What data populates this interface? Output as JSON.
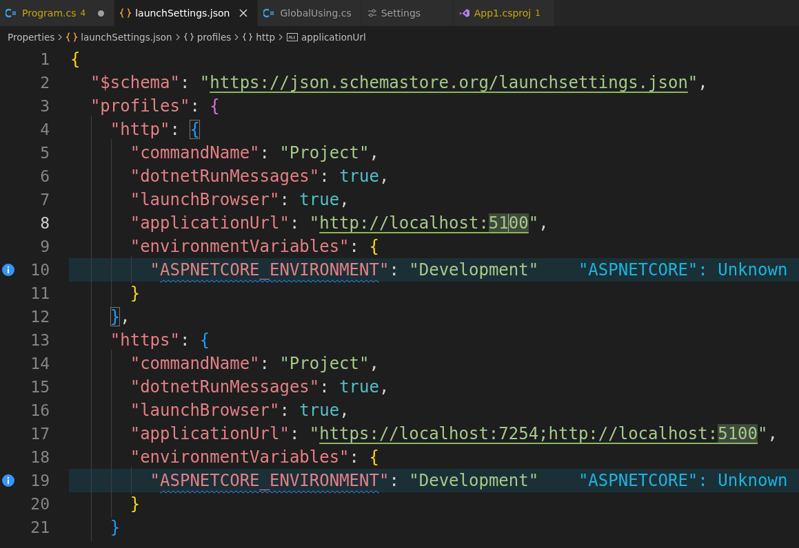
{
  "tabs": [
    {
      "label": "Program.cs",
      "badge": "4",
      "kind": "csharp",
      "warning": true,
      "modified": true,
      "selected": false
    },
    {
      "label": "launchSettings.json",
      "kind": "json",
      "warning": false,
      "modified": false,
      "selected": true
    },
    {
      "label": "GlobalUsing.cs",
      "kind": "csharp",
      "warning": false,
      "modified": false,
      "selected": false
    },
    {
      "label": "Settings",
      "kind": "settings",
      "warning": false,
      "modified": false,
      "selected": false
    },
    {
      "label": "App1.csproj",
      "badge": "1",
      "kind": "project",
      "warning": true,
      "modified": false,
      "selected": false
    }
  ],
  "breadcrumb": [
    {
      "label": "Properties",
      "kind": "folder"
    },
    {
      "label": "launchSettings.json",
      "kind": "json"
    },
    {
      "label": "profiles",
      "kind": "object"
    },
    {
      "label": "http",
      "kind": "object"
    },
    {
      "label": "applicationUrl",
      "kind": "string"
    }
  ],
  "lines": [
    {
      "number": "1",
      "current": false,
      "highlighted": false,
      "info": false,
      "tokens": [
        {
          "text": "{",
          "kind": "b1"
        }
      ]
    },
    {
      "number": "2",
      "current": false,
      "highlighted": false,
      "info": false,
      "tokens": [
        {
          "text": "\"$schema\"",
          "kind": "key"
        },
        {
          "text": ":",
          "kind": "punct"
        },
        {
          "text": "\"",
          "kind": "string",
          "space": true
        },
        {
          "text": "https://json.schemastore.org/launchsettings.json",
          "kind": "link"
        },
        {
          "text": "\"",
          "kind": "string"
        },
        {
          "text": ",",
          "kind": "punct"
        }
      ]
    },
    {
      "number": "3",
      "current": false,
      "highlighted": false,
      "info": false,
      "tokens": [
        {
          "text": "\"profiles\"",
          "kind": "key"
        },
        {
          "text": ":",
          "kind": "punct"
        },
        {
          "text": "{",
          "kind": "b2",
          "space": true
        }
      ]
    },
    {
      "number": "4",
      "current": false,
      "highlighted": false,
      "info": false,
      "tokens": [
        {
          "text": "\"http\"",
          "kind": "key"
        },
        {
          "text": ":",
          "kind": "punct"
        },
        {
          "text": "{",
          "kind": "b3",
          "space": true,
          "boxed": true
        }
      ]
    },
    {
      "number": "5",
      "current": false,
      "highlighted": false,
      "info": false,
      "tokens": [
        {
          "text": "\"commandName\"",
          "kind": "key"
        },
        {
          "text": ":",
          "kind": "punct"
        },
        {
          "text": "\"Project\"",
          "kind": "string",
          "space": true
        },
        {
          "text": ",",
          "kind": "punct"
        }
      ]
    },
    {
      "number": "6",
      "current": false,
      "highlighted": false,
      "info": false,
      "tokens": [
        {
          "text": "\"dotnetRunMessages\"",
          "kind": "key"
        },
        {
          "text": ":",
          "kind": "punct"
        },
        {
          "text": "true",
          "kind": "bool",
          "space": true
        },
        {
          "text": ",",
          "kind": "punct"
        }
      ]
    },
    {
      "number": "7",
      "current": false,
      "highlighted": false,
      "info": false,
      "tokens": [
        {
          "text": "\"launchBrowser\"",
          "kind": "key"
        },
        {
          "text": ":",
          "kind": "punct"
        },
        {
          "text": "true",
          "kind": "bool",
          "space": true
        },
        {
          "text": ",",
          "kind": "punct"
        }
      ]
    },
    {
      "number": "8",
      "current": true,
      "highlighted": false,
      "info": false,
      "tokens": [
        {
          "text": "\"applicationUrl\"",
          "kind": "key"
        },
        {
          "text": ":",
          "kind": "punct"
        },
        {
          "text": "\"",
          "kind": "string",
          "space": true
        },
        {
          "text": "http://localhost:",
          "kind": "link"
        },
        {
          "text": "51",
          "kind": "link",
          "match": true,
          "cursor": true
        },
        {
          "text": "00",
          "kind": "link",
          "match": true
        },
        {
          "text": "\"",
          "kind": "string"
        },
        {
          "text": ",",
          "kind": "punct"
        }
      ]
    },
    {
      "number": "9",
      "current": false,
      "highlighted": false,
      "info": false,
      "tokens": [
        {
          "text": "\"environmentVariables\"",
          "kind": "key"
        },
        {
          "text": ":",
          "kind": "punct"
        },
        {
          "text": "{",
          "kind": "b1",
          "space": true
        }
      ]
    },
    {
      "number": "10",
      "current": false,
      "highlighted": true,
      "info": true,
      "tokens": [
        {
          "text": "\"",
          "kind": "key"
        },
        {
          "text": "ASPNETCORE_ENVIRONMENT",
          "kind": "key",
          "squiggle": true
        },
        {
          "text": "\"",
          "kind": "key"
        },
        {
          "text": ":",
          "kind": "punct"
        },
        {
          "text": "\"Development\"",
          "kind": "string",
          "space": true
        },
        {
          "text": "\"ASPNETCORE\": Unknown",
          "kind": "hint",
          "space": true
        }
      ]
    },
    {
      "number": "11",
      "current": false,
      "highlighted": false,
      "info": false,
      "tokens": [
        {
          "text": "}",
          "kind": "b1"
        }
      ]
    },
    {
      "number": "12",
      "current": false,
      "highlighted": false,
      "info": false,
      "tokens": [
        {
          "text": "}",
          "kind": "b3",
          "boxed": true
        },
        {
          "text": ",",
          "kind": "punct"
        }
      ]
    },
    {
      "number": "13",
      "current": false,
      "highlighted": false,
      "info": false,
      "tokens": [
        {
          "text": "\"https\"",
          "kind": "key"
        },
        {
          "text": ":",
          "kind": "punct"
        },
        {
          "text": "{",
          "kind": "b3",
          "space": true
        }
      ]
    },
    {
      "number": "14",
      "current": false,
      "highlighted": false,
      "info": false,
      "tokens": [
        {
          "text": "\"commandName\"",
          "kind": "key"
        },
        {
          "text": ":",
          "kind": "punct"
        },
        {
          "text": "\"Project\"",
          "kind": "string",
          "space": true
        },
        {
          "text": ",",
          "kind": "punct"
        }
      ]
    },
    {
      "number": "15",
      "current": false,
      "highlighted": false,
      "info": false,
      "tokens": [
        {
          "text": "\"dotnetRunMessages\"",
          "kind": "key"
        },
        {
          "text": ":",
          "kind": "punct"
        },
        {
          "text": "true",
          "kind": "bool",
          "space": true
        },
        {
          "text": ",",
          "kind": "punct"
        }
      ]
    },
    {
      "number": "16",
      "current": false,
      "highlighted": false,
      "info": false,
      "tokens": [
        {
          "text": "\"launchBrowser\"",
          "kind": "key"
        },
        {
          "text": ":",
          "kind": "punct"
        },
        {
          "text": "true",
          "kind": "bool",
          "space": true
        },
        {
          "text": ",",
          "kind": "punct"
        }
      ]
    },
    {
      "number": "17",
      "current": false,
      "highlighted": false,
      "info": false,
      "tokens": [
        {
          "text": "\"applicationUrl\"",
          "kind": "key"
        },
        {
          "text": ":",
          "kind": "punct"
        },
        {
          "text": "\"",
          "kind": "string",
          "space": true
        },
        {
          "text": "https://localhost:7254;http://localhost:",
          "kind": "link"
        },
        {
          "text": "5100",
          "kind": "link",
          "match": true
        },
        {
          "text": "\"",
          "kind": "string"
        },
        {
          "text": ",",
          "kind": "punct"
        }
      ]
    },
    {
      "number": "18",
      "current": false,
      "highlighted": false,
      "info": false,
      "tokens": [
        {
          "text": "\"environmentVariables\"",
          "kind": "key"
        },
        {
          "text": ":",
          "kind": "punct"
        },
        {
          "text": "{",
          "kind": "b1",
          "space": true
        }
      ]
    },
    {
      "number": "19",
      "current": false,
      "highlighted": true,
      "info": true,
      "tokens": [
        {
          "text": "\"",
          "kind": "key"
        },
        {
          "text": "ASPNETCORE_ENVIRONMENT",
          "kind": "key",
          "squiggle": true
        },
        {
          "text": "\"",
          "kind": "key"
        },
        {
          "text": ":",
          "kind": "punct"
        },
        {
          "text": "\"Development\"",
          "kind": "string",
          "space": true
        },
        {
          "text": "\"ASPNETCORE\": Unknown",
          "kind": "hint",
          "space": true
        }
      ]
    },
    {
      "number": "20",
      "current": false,
      "highlighted": false,
      "info": false,
      "tokens": [
        {
          "text": "}",
          "kind": "b1"
        }
      ]
    },
    {
      "number": "21",
      "current": false,
      "highlighted": false,
      "info": false,
      "tokens": [
        {
          "text": "}",
          "kind": "b3"
        }
      ]
    }
  ]
}
